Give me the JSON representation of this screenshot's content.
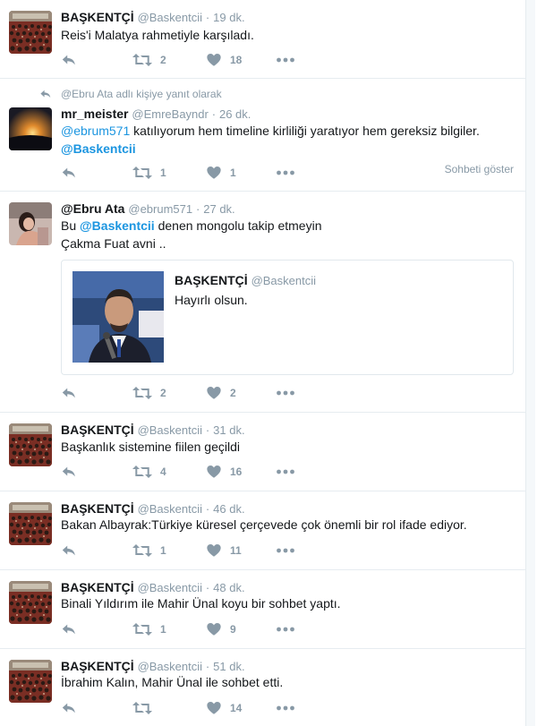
{
  "tweets": [
    {
      "name": "BAŞKENTÇİ",
      "handle": "@Baskentcii",
      "dot": "·",
      "time": "19 dk.",
      "text": "Reis'i Malatya rahmetiyle karşıladı.",
      "retweets": "2",
      "likes": "18"
    },
    {
      "reply_context": "@Ebru Ata adlı kişiye yanıt olarak",
      "name": "mr_meister",
      "handle": "@EmreBayndr",
      "dot": "·",
      "time": "26 dk.",
      "mention": "@ebrum571",
      "text": " katılıyorum hem timeline kirliliği yaratıyor hem gereksiz bilgiler.",
      "mention2": "@Baskentcii",
      "retweets": "1",
      "likes": "1",
      "show_conversation": "Sohbeti göster"
    },
    {
      "name": "@Ebru Ata",
      "handle": "@ebrum571",
      "dot": "·",
      "time": "27 dk.",
      "prefix": "Bu ",
      "mention": "@Baskentcii",
      "text": "  denen mongolu takip etmeyin",
      "line2": "Çakma Fuat avni ..",
      "quote": {
        "name": "BAŞKENTÇİ",
        "handle": "@Baskentcii",
        "text": "Hayırlı olsun."
      },
      "retweets": "2",
      "likes": "2"
    },
    {
      "name": "BAŞKENTÇİ",
      "handle": "@Baskentcii",
      "dot": "·",
      "time": "31 dk.",
      "text": "Başkanlık sistemine fiilen geçildi",
      "retweets": "4",
      "likes": "16"
    },
    {
      "name": "BAŞKENTÇİ",
      "handle": "@Baskentcii",
      "dot": "·",
      "time": "46 dk.",
      "text": "Bakan Albayrak:Türkiye küresel çerçevede çok önemli bir rol ifade ediyor.",
      "retweets": "1",
      "likes": "11"
    },
    {
      "name": "BAŞKENTÇİ",
      "handle": "@Baskentcii",
      "dot": "·",
      "time": "48 dk.",
      "text": "Binali Yıldırım ile Mahir Ünal koyu bir sohbet yaptı.",
      "retweets": "1",
      "likes": "9"
    },
    {
      "name": "BAŞKENTÇİ",
      "handle": "@Baskentcii",
      "dot": "·",
      "time": "51 dk.",
      "text": "İbrahim Kalın, Mahir Ünal ile sohbet etti.",
      "retweets": "",
      "likes": "14"
    }
  ],
  "colors": {
    "text": "#14171a",
    "secondary": "#8899a6",
    "link": "#1b95e0",
    "border": "#e6ecf0"
  },
  "icons": {
    "reply": "reply-icon",
    "retweet": "retweet-icon",
    "like": "heart-icon",
    "more": "more-icon"
  }
}
